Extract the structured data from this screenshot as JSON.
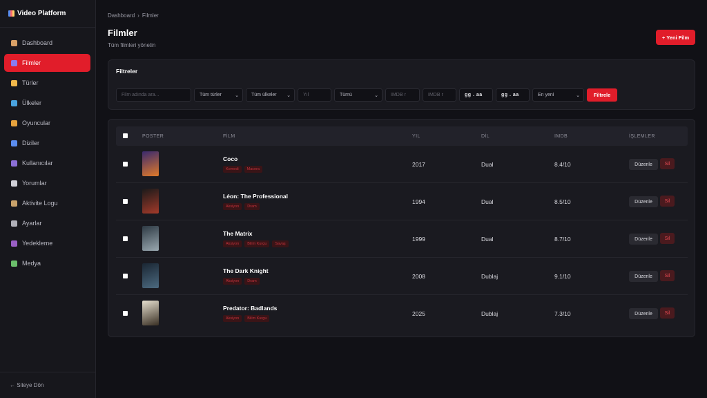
{
  "app": {
    "name": "Video Platform"
  },
  "sidebar": {
    "items": [
      {
        "label": "Dashboard",
        "icon": "house-icon",
        "color": "#d9a066"
      },
      {
        "label": "Filmler",
        "icon": "film-icon",
        "color": "#8a7cf0",
        "active": true
      },
      {
        "label": "Türler",
        "icon": "tag-icon",
        "color": "#f2b84b"
      },
      {
        "label": "Ülkeler",
        "icon": "globe-icon",
        "color": "#4aa3df"
      },
      {
        "label": "Oyuncular",
        "icon": "masks-icon",
        "color": "#e8a33d"
      },
      {
        "label": "Diziler",
        "icon": "tv-icon",
        "color": "#5b8def"
      },
      {
        "label": "Kullanıcılar",
        "icon": "user-icon",
        "color": "#8b6fd6"
      },
      {
        "label": "Yorumlar",
        "icon": "speech-bubble-icon",
        "color": "#d0d0d8"
      },
      {
        "label": "Aktivite Logu",
        "icon": "clipboard-icon",
        "color": "#c9a26b"
      },
      {
        "label": "Ayarlar",
        "icon": "gear-icon",
        "color": "#b0b0b8"
      },
      {
        "label": "Yedekleme",
        "icon": "floppy-disk-icon",
        "color": "#9a5fc4"
      },
      {
        "label": "Medya",
        "icon": "image-icon",
        "color": "#6bbf6b"
      }
    ],
    "footer_link": "← Siteye Dön"
  },
  "breadcrumb": {
    "root": "Dashboard",
    "separator": "›",
    "current": "Filmler"
  },
  "header": {
    "title": "Filmler",
    "subtitle": "Tüm filmleri yönetin",
    "new_button": "+ Yeni Film"
  },
  "filters": {
    "title": "Filtreler",
    "search_placeholder": "Film adında ara...",
    "genre": "Tüm türler",
    "country": "Tüm ülkeler",
    "year_placeholder": "Yıl",
    "language": "Tümü",
    "imdb_min_placeholder": "IMDB r",
    "imdb_max_placeholder": "IMDB r",
    "date_from": "gg . aa",
    "date_to": "gg . aa",
    "sort": "En yeni",
    "apply_button": "Filtrele"
  },
  "table": {
    "headers": {
      "poster": "POSTER",
      "film": "FİLM",
      "year": "YIL",
      "language": "DİL",
      "imdb": "IMDB",
      "actions": "İŞLEMLER"
    },
    "edit_label": "Düzenle",
    "delete_label": "Sil",
    "rows": [
      {
        "title": "Coco",
        "tags": [
          "Komedi",
          "Macera"
        ],
        "year": "2017",
        "language": "Dual",
        "imdb": "8.4/10",
        "poster_colors": [
          "#3a2a6e",
          "#e07a2a"
        ]
      },
      {
        "title": "Léon: The Professional",
        "tags": [
          "Aksiyon",
          "Dram"
        ],
        "year": "1994",
        "language": "Dual",
        "imdb": "8.5/10",
        "poster_colors": [
          "#1b1a1a",
          "#a33a2a"
        ]
      },
      {
        "title": "The Matrix",
        "tags": [
          "Aksiyon",
          "Bilim Kurgu",
          "Savaş"
        ],
        "year": "1999",
        "language": "Dual",
        "imdb": "8.7/10",
        "poster_colors": [
          "#2e3a44",
          "#9aa8b0"
        ]
      },
      {
        "title": "The Dark Knight",
        "tags": [
          "Aksiyon",
          "Dram"
        ],
        "year": "2008",
        "language": "Dublaj",
        "imdb": "9.1/10",
        "poster_colors": [
          "#1a2633",
          "#4c6a80"
        ]
      },
      {
        "title": "Predator: Badlands",
        "tags": [
          "Aksiyon",
          "Bilim Kurgu"
        ],
        "year": "2025",
        "language": "Dublaj",
        "imdb": "7.3/10",
        "poster_colors": [
          "#e6dfcf",
          "#3a3024"
        ]
      }
    ]
  }
}
